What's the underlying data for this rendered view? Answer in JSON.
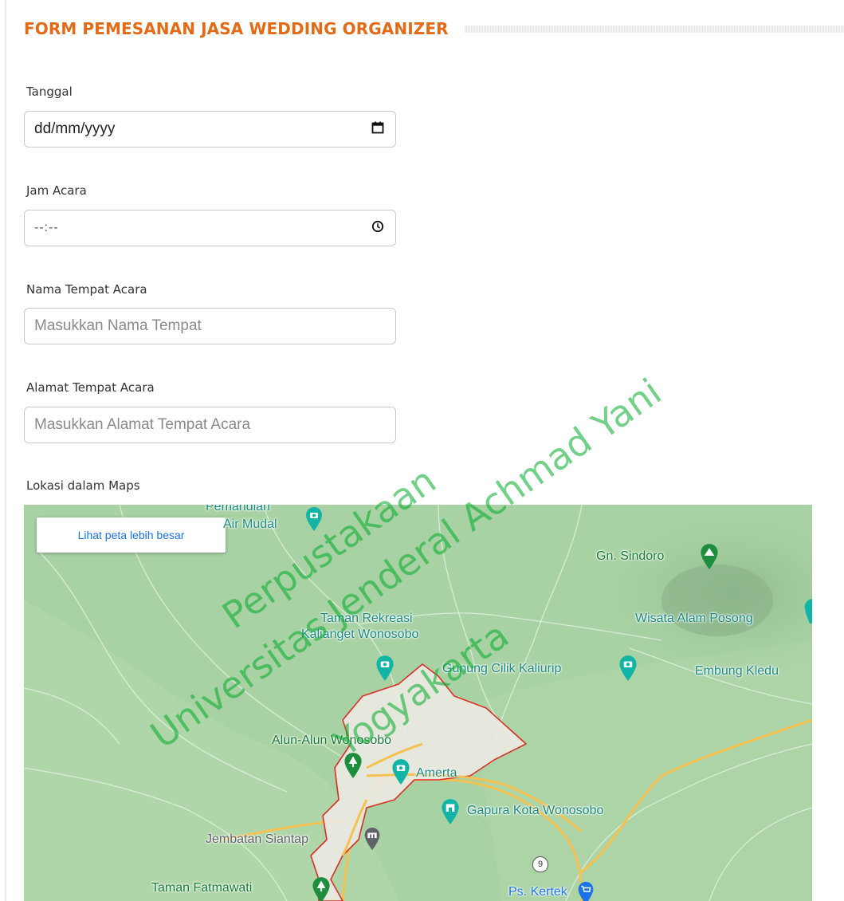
{
  "form": {
    "title": "FORM PEMESANAN JASA WEDDING ORGANIZER",
    "fields": {
      "tanggal": {
        "label": "Tanggal",
        "value": "dd/mm/yyyy"
      },
      "jam": {
        "label": "Jam Acara",
        "value": "--:--"
      },
      "nama_tempat": {
        "label": "Nama Tempat Acara",
        "placeholder": "Masukkan Nama Tempat"
      },
      "alamat_tempat": {
        "label": "Alamat Tempat Acara",
        "placeholder": "Masukkan Alamat Tempat Acara"
      }
    },
    "maps_label": "Lokasi dalam Maps"
  },
  "map": {
    "button": "Lihat peta lebih besar",
    "labels": {
      "pemandian": "Pemandian",
      "air_mudal": "Air Mudal",
      "gn_sindoro": "Gn. Sindoro",
      "taman_rekreasi_1": "Taman Rekreasi",
      "taman_rekreasi_2": "Kalianget Wonosobo",
      "wisata_alam": "Wisata Alam Posong",
      "gunung_cilik": "Gunung Cilik Kaliurip",
      "embung": "Embung Kledu",
      "alun_alun": "Alun-Alun Wonosobo",
      "amerta": "Amerta",
      "gapura": "Gapura Kota Wonosobo",
      "jembatan": "Jembatan Siantap",
      "taman_fatmawati": "Taman Fatmawati",
      "ps_kertek": "Ps. Kertek",
      "road_number": "9"
    },
    "colors": {
      "poi_green": "#1e8e3e",
      "poi_teal": "#12b5a5",
      "poi_blue": "#1a73e8",
      "poi_gray": "#5f6368",
      "boundary": "#d93025",
      "road": "#f5c150"
    }
  },
  "watermark": {
    "line1": "Perpustakaan",
    "line2": "Universitas Jenderal Achmad Yani",
    "line3": "Yogyakarta"
  }
}
